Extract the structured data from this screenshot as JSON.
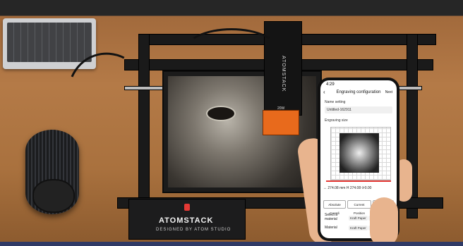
{
  "colors": {
    "laser_shield": "#e86a1c",
    "app_accent_red": "#e53935",
    "frame": "#1a1a1a"
  },
  "machine": {
    "brand": "ATOMSTACK",
    "tagline": "DESIGNED BY ATOM STUDIO",
    "head_label": "ATOMSTACK",
    "head_small": "20W"
  },
  "app": {
    "status_time": "4:29",
    "back_icon": "chevron-left-icon",
    "title": "Engraving configuration",
    "next_label": "Next",
    "name_setting_label": "Name setting",
    "name_value": "Untitled-162911",
    "engraving_size_label": "Engraving size",
    "width_value": "274.08",
    "width_unit": "mm",
    "height_label": "H",
    "height_value": "274.08",
    "angle_value": "0.00",
    "tabs": [
      "Absolute Coordi",
      "Current Position",
      "Laser"
    ],
    "material_label": "Select a material",
    "material_prefix": "Material",
    "materials": [
      "Kraft Paper",
      "1.0",
      "Kraft Paper",
      "1.0"
    ]
  }
}
